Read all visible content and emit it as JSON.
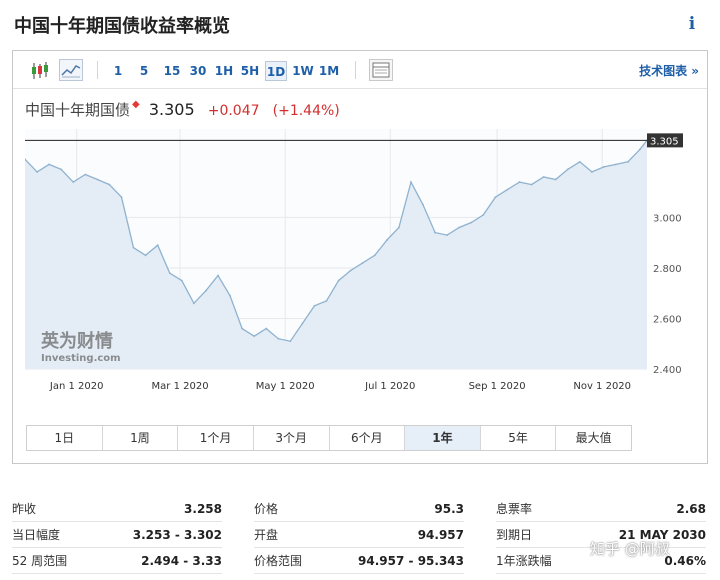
{
  "header": {
    "title": "中国十年期国债收益率概览",
    "info_icon": "info-icon"
  },
  "toolbar": {
    "periods": [
      "1",
      "5",
      "15",
      "30",
      "1H",
      "5H",
      "1D",
      "1W",
      "1M"
    ],
    "active_period": "1D",
    "tech_chart_link": "技术图表 »"
  },
  "quote": {
    "name": "中国十年期国债",
    "price": "3.305",
    "change": "+0.047",
    "change_pct": "(+1.44%)"
  },
  "ranges": {
    "items": [
      "1日",
      "1周",
      "1个月",
      "3个月",
      "6个月",
      "1年",
      "5年",
      "最大值"
    ],
    "active": "1年"
  },
  "chart_data": {
    "type": "area",
    "x_tick_labels": [
      "Jan 1 2020",
      "Mar 1 2020",
      "May 1 2020",
      "Jul 1 2020",
      "Sep 1 2020",
      "Nov 1 2020"
    ],
    "x_tick_dates": [
      "2020-01-01",
      "2020-03-01",
      "2020-05-01",
      "2020-07-01",
      "2020-09-01",
      "2020-11-01"
    ],
    "x_range": [
      "2019-12-02",
      "2020-11-27"
    ],
    "y_tick_labels": [
      "3.000",
      "2.800",
      "2.600",
      "2.400"
    ],
    "y_ticks": [
      3.0,
      2.8,
      2.6,
      2.4
    ],
    "ylim": [
      2.4,
      3.35
    ],
    "last_value_label": "3.305",
    "last_value": 3.305,
    "watermark_brand": "英为财情",
    "watermark_site": "Investing.com",
    "dates": [
      "2019-12-02",
      "2019-12-09",
      "2019-12-16",
      "2019-12-23",
      "2019-12-30",
      "2020-01-06",
      "2020-01-13",
      "2020-01-20",
      "2020-01-27",
      "2020-02-03",
      "2020-02-10",
      "2020-02-17",
      "2020-02-24",
      "2020-03-02",
      "2020-03-09",
      "2020-03-16",
      "2020-03-23",
      "2020-03-30",
      "2020-04-06",
      "2020-04-13",
      "2020-04-20",
      "2020-04-27",
      "2020-05-04",
      "2020-05-11",
      "2020-05-18",
      "2020-05-25",
      "2020-06-01",
      "2020-06-08",
      "2020-06-15",
      "2020-06-22",
      "2020-06-29",
      "2020-07-06",
      "2020-07-13",
      "2020-07-20",
      "2020-07-27",
      "2020-08-03",
      "2020-08-10",
      "2020-08-17",
      "2020-08-24",
      "2020-08-31",
      "2020-09-07",
      "2020-09-14",
      "2020-09-21",
      "2020-09-28",
      "2020-10-05",
      "2020-10-12",
      "2020-10-19",
      "2020-10-26",
      "2020-11-02",
      "2020-11-09",
      "2020-11-16",
      "2020-11-23",
      "2020-11-27"
    ],
    "values": [
      3.23,
      3.18,
      3.21,
      3.19,
      3.14,
      3.17,
      3.15,
      3.13,
      3.08,
      2.88,
      2.85,
      2.89,
      2.78,
      2.75,
      2.66,
      2.71,
      2.77,
      2.69,
      2.56,
      2.53,
      2.56,
      2.52,
      2.51,
      2.58,
      2.65,
      2.67,
      2.75,
      2.79,
      2.82,
      2.85,
      2.91,
      2.96,
      3.14,
      3.05,
      2.94,
      2.93,
      2.96,
      2.98,
      3.01,
      3.08,
      3.11,
      3.14,
      3.13,
      3.16,
      3.15,
      3.19,
      3.22,
      3.18,
      3.2,
      3.21,
      3.22,
      3.27,
      3.305
    ],
    "colors": {
      "line": "#8fb2cf",
      "fill": "#e4edf5",
      "last_line": "#222222",
      "last_tag": "#333333"
    }
  },
  "stats": {
    "col1": [
      {
        "label": "昨收",
        "value": "3.258"
      },
      {
        "label": "当日幅度",
        "value": "3.253 - 3.302"
      },
      {
        "label": "52 周范围",
        "value": "2.494 - 3.33"
      }
    ],
    "col2": [
      {
        "label": "价格",
        "value": "95.3"
      },
      {
        "label": "开盘",
        "value": "94.957"
      },
      {
        "label": "价格范围",
        "value": "94.957 - 95.343"
      }
    ],
    "col3": [
      {
        "label": "息票率",
        "value": "2.68"
      },
      {
        "label": "到期日",
        "value": "21 MAY 2030"
      },
      {
        "label": "1年涨跌幅",
        "value": "0.46%"
      }
    ]
  },
  "watermark": "知乎 @阿叔"
}
